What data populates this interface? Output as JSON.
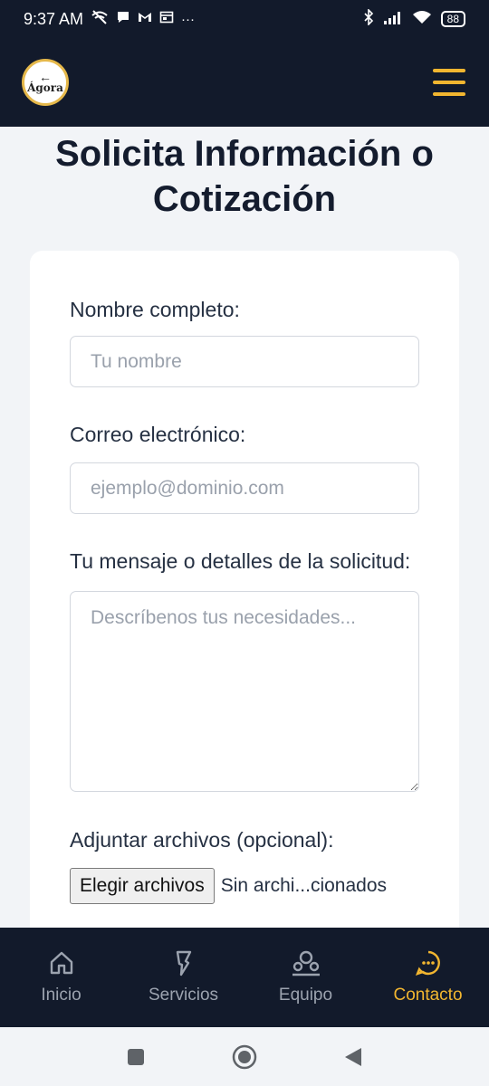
{
  "status_bar": {
    "time": "9:37 AM",
    "icons": [
      "wifi-off-icon",
      "chat-icon",
      "gmail-icon",
      "calendar-icon",
      "more-icon"
    ],
    "right_icons": [
      "bluetooth-icon",
      "signal-icon",
      "wifi-icon"
    ],
    "battery": "88"
  },
  "header": {
    "logo_text": "Ágora",
    "menu_icon": "hamburger-menu-icon",
    "accent_color": "#f2b630",
    "background_color": "#121a2b"
  },
  "page": {
    "title": "Solicita Información o Cotización"
  },
  "form": {
    "name_label": "Nombre completo:",
    "name_placeholder": "Tu nombre",
    "email_label": "Correo electrónico:",
    "email_placeholder": "ejemplo@dominio.com",
    "message_label": "Tu mensaje o detalles de la solicitud:",
    "message_placeholder": "Descríbenos tus necesidades...",
    "attach_label": "Adjuntar archivos (opcional):",
    "file_button": "Elegir archivos",
    "file_status": "Sin archi...cionados"
  },
  "bottom_nav": {
    "items": [
      {
        "label": "Inicio",
        "icon": "home-icon"
      },
      {
        "label": "Servicios",
        "icon": "services-icon"
      },
      {
        "label": "Equipo",
        "icon": "team-icon"
      },
      {
        "label": "Contacto",
        "icon": "chat-bubble-icon"
      }
    ],
    "active": "Contacto"
  },
  "system_nav": {
    "icons": [
      "recents-icon",
      "home-circle-icon",
      "back-icon"
    ]
  }
}
